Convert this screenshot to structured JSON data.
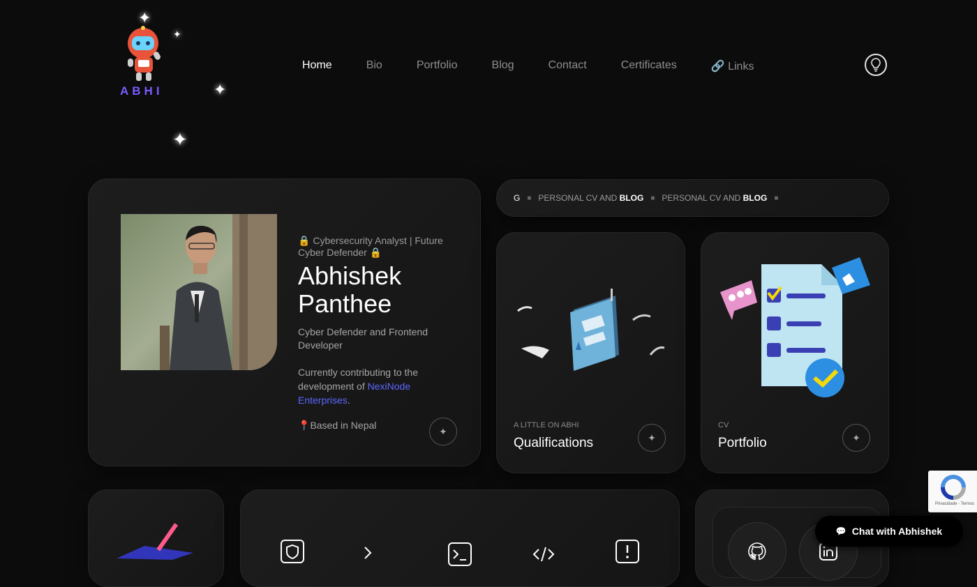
{
  "logo": {
    "text": "ABHI"
  },
  "nav": {
    "items": [
      {
        "label": "Home",
        "active": true
      },
      {
        "label": "Bio"
      },
      {
        "label": "Portfolio"
      },
      {
        "label": "Blog"
      },
      {
        "label": "Contact"
      },
      {
        "label": "Certificates"
      },
      {
        "label": "Links",
        "icon": "link-icon"
      }
    ],
    "theme_toggle_icon": "lightbulb-icon"
  },
  "profile": {
    "role": "Cybersecurity Analyst | Future Cyber Defender",
    "name_line1": "Abhishek",
    "name_line2": "Panthee",
    "description": "Cyber Defender and Frontend Developer",
    "contrib_prefix": "Currently contributing to the development of",
    "contrib_link": "NexiNode Enterprises",
    "contrib_suffix": ".",
    "location": "Based in Nepal"
  },
  "marquee": {
    "first_partial": "G",
    "items": [
      {
        "normal": "PERSONAL CV AND ",
        "bold": "BLOG"
      },
      {
        "normal": "PERSONAL CV AND ",
        "bold": "BLOG"
      }
    ]
  },
  "cards": {
    "qualifications": {
      "small": "A LITTLE ON ABHI",
      "title": "Qualifications"
    },
    "portfolio": {
      "small": "CV",
      "title": "Portfolio"
    }
  },
  "recaptcha": {
    "text": "Privacidade - Termos"
  },
  "chat": {
    "label": "Chat with Abhishek",
    "icon": "chat-bubble-icon"
  },
  "colors": {
    "accent": "#7b5cff",
    "link": "#5b67ff",
    "background": "#0c0c0c"
  }
}
